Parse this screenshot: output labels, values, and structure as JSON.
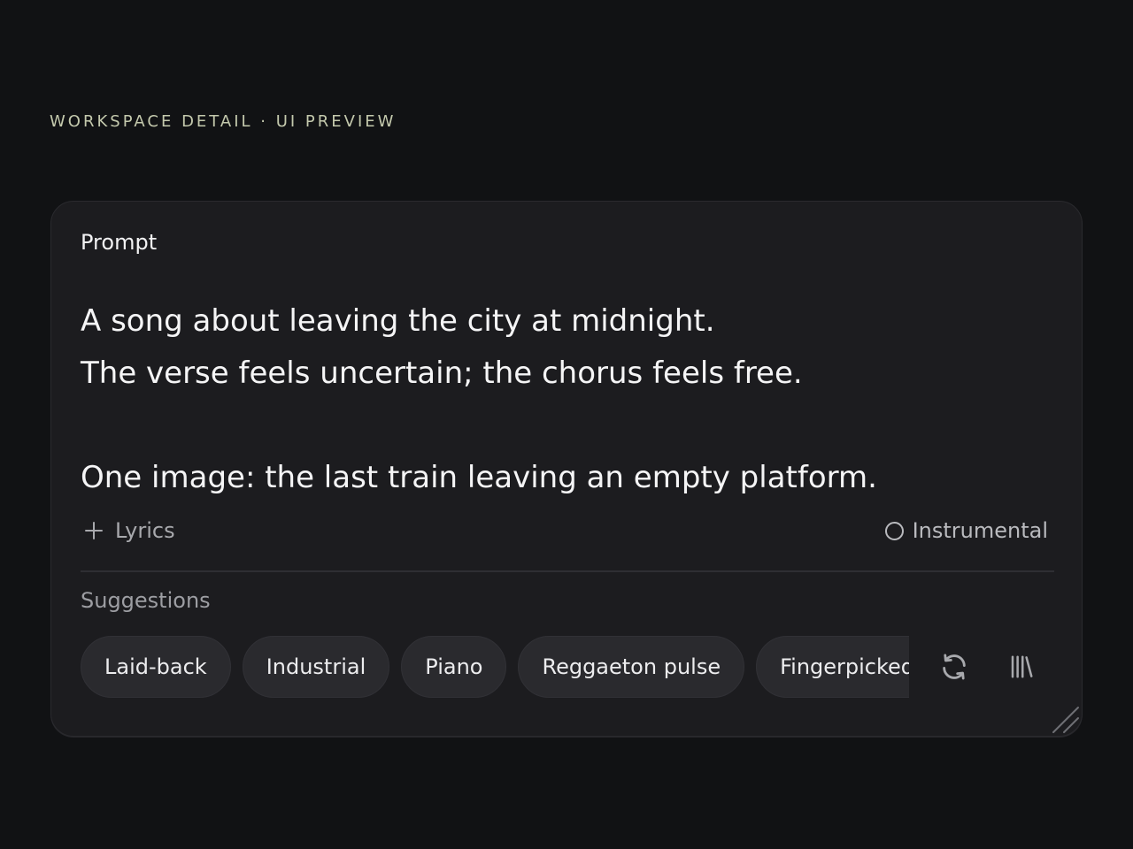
{
  "header": {
    "eyebrow": "WORKSPACE DETAIL · UI PREVIEW"
  },
  "prompt_card": {
    "title": "Prompt",
    "text": "A song about leaving the city at midnight.\nThe verse feels uncertain; the chorus feels free.\n\nOne image: the last train leaving an empty platform.",
    "lyrics_label": "Lyrics",
    "instrumental_label": "Instrumental",
    "instrumental_selected": false
  },
  "suggestions": {
    "title": "Suggestions",
    "chips": [
      "Laid-back",
      "Industrial",
      "Piano",
      "Reggaeton pulse",
      "Fingerpicked gu"
    ]
  },
  "icons": {
    "lyrics": "plus-icon",
    "instrumental": "radio-icon",
    "refresh": "refresh-icon",
    "library": "library-icon",
    "resize": "resize-grip-icon"
  }
}
